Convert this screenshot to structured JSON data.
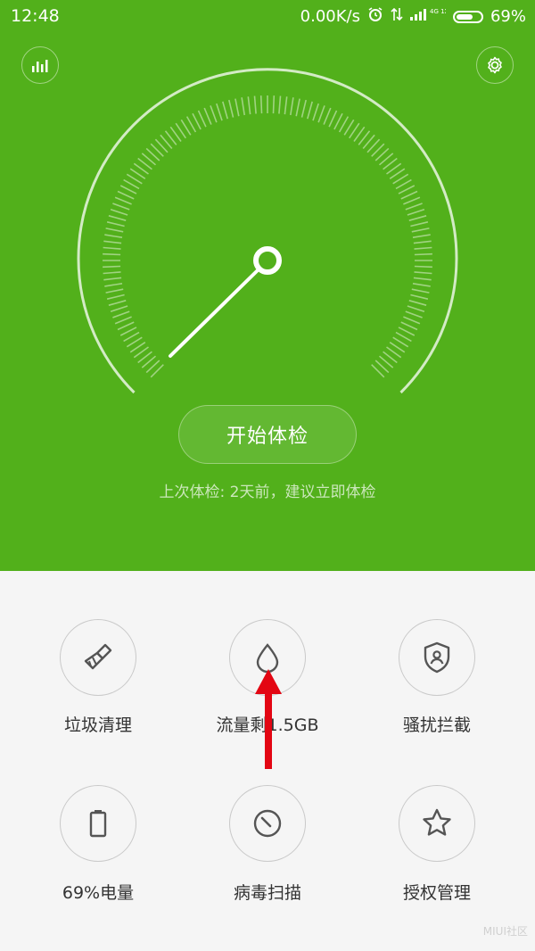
{
  "status": {
    "time": "12:48",
    "speed": "0.00K/s",
    "network": "4G 1X",
    "battery_pct": "69%",
    "battery_level": 0.69
  },
  "header": {
    "stats_icon": "bar-chart-icon",
    "settings_icon": "gear-icon"
  },
  "gauge": {
    "needle_icon": "gauge-needle"
  },
  "main": {
    "start_label": "开始体检",
    "hint": "上次体检: 2天前，建议立即体检"
  },
  "tiles": [
    {
      "label": "垃圾清理",
      "icon": "broom-icon"
    },
    {
      "label": "流量剩1.5GB",
      "icon": "water-drop-icon"
    },
    {
      "label": "骚扰拦截",
      "icon": "shield-user-icon"
    },
    {
      "label": "69%电量",
      "icon": "battery-icon"
    },
    {
      "label": "病毒扫描",
      "icon": "virus-scan-icon"
    },
    {
      "label": "授权管理",
      "icon": "star-icon"
    }
  ],
  "overlay": {
    "arrow": "red-up-arrow-icon",
    "watermark": "MIUI社区"
  },
  "colors": {
    "primary_green": "#52b01b",
    "arrow_red": "#e30613",
    "background": "#f5f5f5"
  }
}
